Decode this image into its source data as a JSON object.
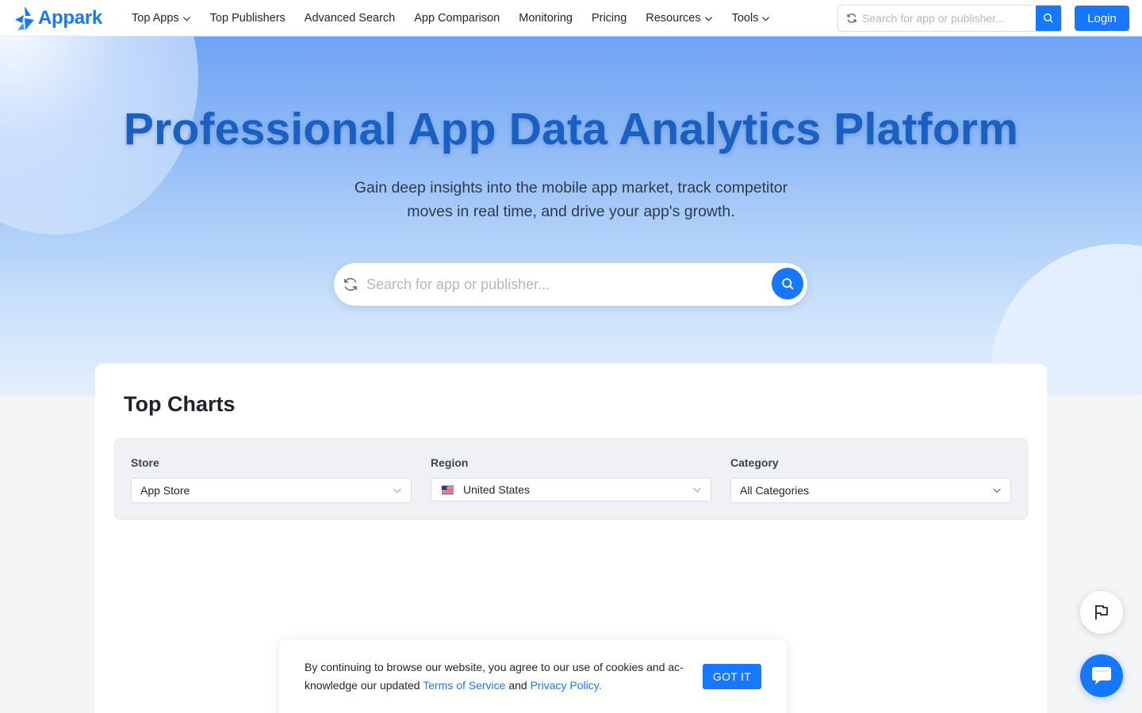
{
  "brand": {
    "name": "Appark",
    "color": "#1677ff"
  },
  "nav": {
    "items": [
      {
        "label": "Top Apps",
        "dropdown": true
      },
      {
        "label": "Top Publishers",
        "dropdown": false
      },
      {
        "label": "Advanced Search",
        "dropdown": false
      },
      {
        "label": "App Comparison",
        "dropdown": false
      },
      {
        "label": "Monitoring",
        "dropdown": false
      },
      {
        "label": "Pricing",
        "dropdown": false
      },
      {
        "label": "Resources",
        "dropdown": true
      },
      {
        "label": "Tools",
        "dropdown": true
      }
    ],
    "search_placeholder": "Search for app or publisher...",
    "login_label": "Login"
  },
  "hero": {
    "title": "Professional App Data Analytics Platform",
    "subtitle": "Gain deep insights into the mobile app market, track competitor moves in real time, and drive your app's growth.",
    "search_placeholder": "Search for app or publisher..."
  },
  "top_charts": {
    "title": "Top Charts",
    "filters": {
      "store": {
        "label": "Store",
        "value": "App Store"
      },
      "region": {
        "label": "Region",
        "value": "United States",
        "flag": "us-flag-icon"
      },
      "category": {
        "label": "Category",
        "value": "All Categories"
      }
    }
  },
  "cookie": {
    "text_before": "By continuing to browse our website, you agree to our use of cookies and ac­knowledge our updated ",
    "terms_link": "Terms of Service",
    "and": " and ",
    "privacy_link": "Privacy Policy",
    "period": ".",
    "button_label": "GOT IT"
  },
  "icons": {
    "feedback": "flag-icon",
    "chat": "chat-icon"
  }
}
